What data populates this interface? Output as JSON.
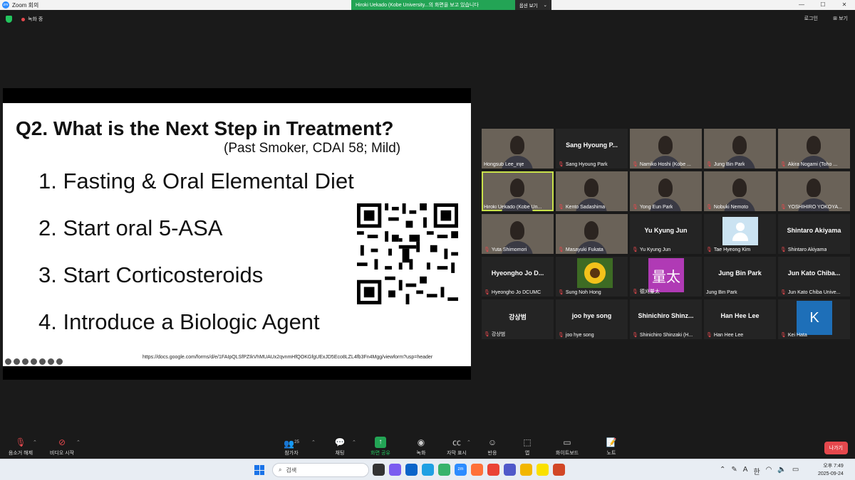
{
  "window": {
    "app_title": "Zoom 회의",
    "banner_message": "Hiroki Uekado (Kobe University...의 화면을 보고 있습니다",
    "banner_option": "옵션 보기",
    "min": "—",
    "max": "☐",
    "close": "✕"
  },
  "meeting_bar": {
    "recording_label": "녹화 중",
    "login_label": "로그인",
    "view_label": "보기"
  },
  "slide": {
    "title": "Q2. What is the Next Step in Treatment?",
    "subtitle": "(Past Smoker, CDAI 58; Mild)",
    "options": [
      "1. Fasting & Oral Elemental Diet",
      "2. Start oral 5-ASA",
      "3. Start Corticosteroids",
      "4. Introduce a Biologic Agent"
    ],
    "url": "https://docs.google.com/forms/d/e/1FAIpQLSfPZIkVhMUAUx2qvnmHfQOKGfgUExJD5Eco8LZL4fb3Fn4Mgg/viewform?usp=header"
  },
  "participants": [
    {
      "name": "Hongsub Lee_inje",
      "display": "",
      "video": true,
      "muted": false
    },
    {
      "name": "Sang Hyoung Park",
      "display": "Sang Hyoung P...",
      "video": false,
      "muted": true
    },
    {
      "name": "Namiko Hoshi (Kobe ...",
      "display": "",
      "video": true,
      "muted": true
    },
    {
      "name": "Jung Bin Park",
      "display": "",
      "video": true,
      "muted": true
    },
    {
      "name": "Akira Nogami (Toho ...",
      "display": "",
      "video": true,
      "muted": true
    },
    {
      "name": "Hiroki Uekado (Kobe Un...",
      "display": "",
      "video": true,
      "muted": false,
      "active": true
    },
    {
      "name": "Kento Sadashima",
      "display": "",
      "video": true,
      "muted": true
    },
    {
      "name": "Yong Eun Park",
      "display": "",
      "video": true,
      "muted": true
    },
    {
      "name": "Nobuki Nemoto",
      "display": "",
      "video": true,
      "muted": true
    },
    {
      "name": "YOSHIHIRO YOKOYA...",
      "display": "",
      "video": true,
      "muted": true
    },
    {
      "name": "Yuta Shimomori",
      "display": "",
      "video": true,
      "muted": true
    },
    {
      "name": "Masayuki Fukata",
      "display": "",
      "video": true,
      "muted": true
    },
    {
      "name": "Yu Kyung Jun",
      "display": "Yu Kyung Jun",
      "video": false,
      "muted": true
    },
    {
      "name": "Tae Hyeong Kim",
      "display": "",
      "video": false,
      "muted": true,
      "avatar": "profile"
    },
    {
      "name": "Shintaro Akiyama",
      "display": "Shintaro Akiyama",
      "video": false,
      "muted": true
    },
    {
      "name": "Hyeongho Jo DCUMC",
      "display": "Hyeongho Jo D...",
      "video": false,
      "muted": true
    },
    {
      "name": "Sung Noh Hong",
      "display": "",
      "video": false,
      "muted": true,
      "avatar": "sunflower"
    },
    {
      "name": "德刈量太",
      "display": "",
      "video": false,
      "muted": true,
      "avatar": "text",
      "avatar_text": "量太",
      "avatar_color": "#b03ab5"
    },
    {
      "name": "Jung Bin Park",
      "display": "Jung Bin Park",
      "video": false,
      "muted": false
    },
    {
      "name": "Jun Kato Chiba Unive...",
      "display": "Jun Kato Chiba...",
      "video": false,
      "muted": true
    },
    {
      "name": "강상범",
      "display": "강상범",
      "video": false,
      "muted": true
    },
    {
      "name": "joo hye song",
      "display": "joo hye song",
      "video": false,
      "muted": true
    },
    {
      "name": "Shinichiro Shinzaki (H...",
      "display": "Shinichiro Shinz...",
      "video": false,
      "muted": true
    },
    {
      "name": "Han Hee Lee",
      "display": "Han Hee Lee",
      "video": false,
      "muted": true
    },
    {
      "name": "Kei Hata",
      "display": "",
      "video": false,
      "muted": true,
      "avatar": "text",
      "avatar_text": "K",
      "avatar_color": "#1e6fb8"
    }
  ],
  "toolbar": {
    "unmute": "음소거 해제",
    "start_video": "비디오 시작",
    "participants": "참가자",
    "participants_count": "25",
    "chat": "채팅",
    "share": "화면 공유",
    "record": "녹화",
    "captions": "자막 표시",
    "reactions": "반응",
    "apps": "앱",
    "whiteboard": "화이트보드",
    "notes": "노트",
    "leave": "나가기"
  },
  "taskbar": {
    "search_placeholder": "검색",
    "ime_a": "A",
    "ime_han": "한",
    "time": "오후 7:49",
    "date": "2025-09-24"
  }
}
